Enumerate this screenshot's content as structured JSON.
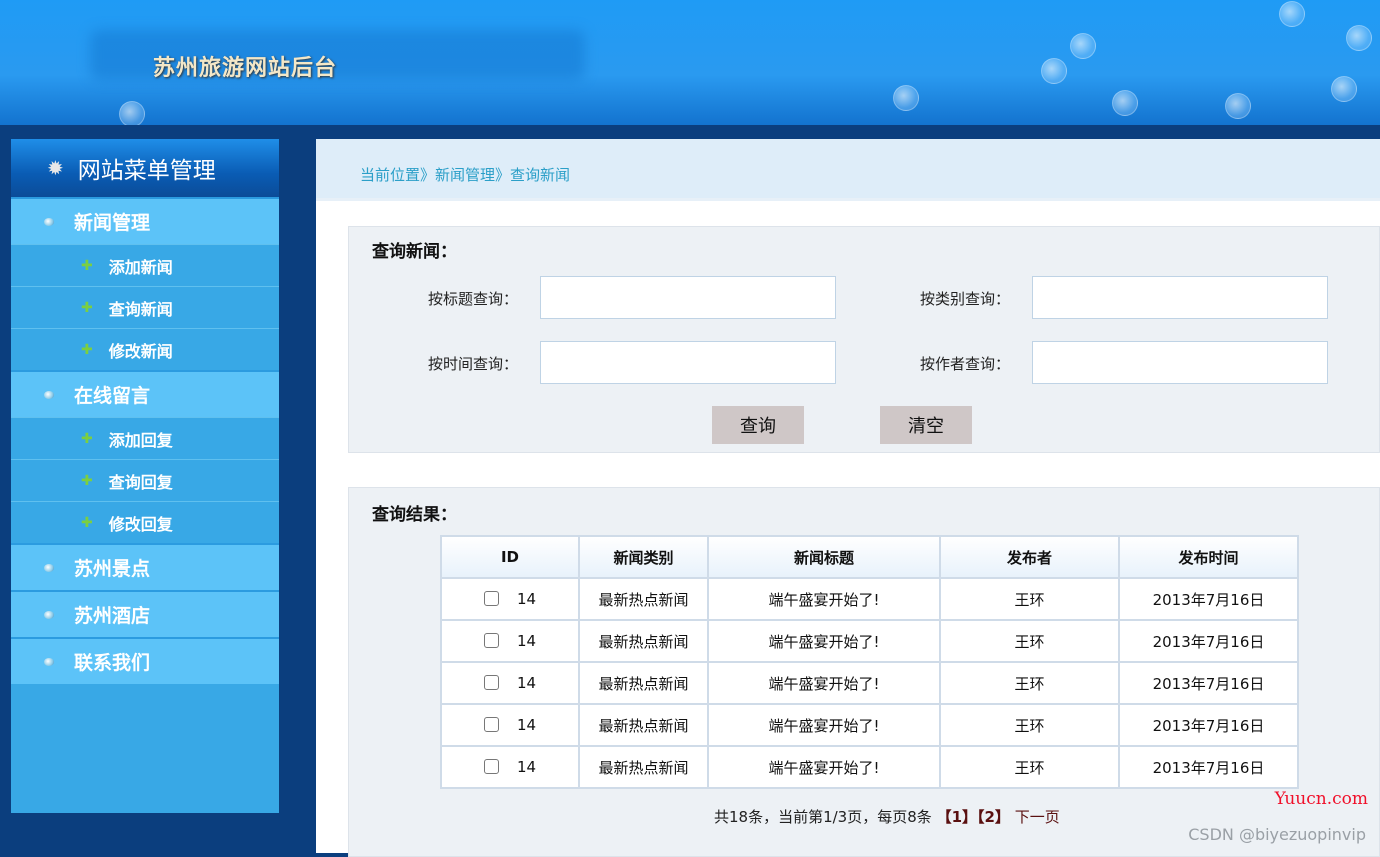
{
  "header": {
    "title": "苏州旅游网站后台"
  },
  "sidebar": {
    "title": "网站菜单管理",
    "items": [
      {
        "label": "新闻管理",
        "type": "group"
      },
      {
        "label": "添加新闻",
        "type": "sub"
      },
      {
        "label": "查询新闻",
        "type": "sub"
      },
      {
        "label": "修改新闻",
        "type": "sub"
      },
      {
        "label": "在线留言",
        "type": "group"
      },
      {
        "label": "添加回复",
        "type": "sub"
      },
      {
        "label": "查询回复",
        "type": "sub"
      },
      {
        "label": "修改回复",
        "type": "sub"
      },
      {
        "label": "苏州景点",
        "type": "group"
      },
      {
        "label": "苏州酒店",
        "type": "group"
      },
      {
        "label": "联系我们",
        "type": "group"
      }
    ]
  },
  "breadcrumb": "当前位置》新闻管理》查询新闻",
  "query": {
    "title": "查询新闻：",
    "title_label": "按标题查询：",
    "category_label": "按类别查询：",
    "time_label": "按时间查询：",
    "author_label": "按作者查询：",
    "search_button": "查询",
    "clear_button": "清空"
  },
  "results": {
    "title": "查询结果：",
    "columns": [
      "ID",
      "新闻类别",
      "新闻标题",
      "发布者",
      "发布时间"
    ],
    "rows": [
      [
        "14",
        "最新热点新闻",
        "端午盛宴开始了!",
        "王环",
        "2013年7月16日"
      ],
      [
        "14",
        "最新热点新闻",
        "端午盛宴开始了!",
        "王环",
        "2013年7月16日"
      ],
      [
        "14",
        "最新热点新闻",
        "端午盛宴开始了!",
        "王环",
        "2013年7月16日"
      ],
      [
        "14",
        "最新热点新闻",
        "端午盛宴开始了!",
        "王环",
        "2013年7月16日"
      ],
      [
        "14",
        "最新热点新闻",
        "端午盛宴开始了!",
        "王环",
        "2013年7月16日"
      ]
    ]
  },
  "pager": {
    "summary": "共18条，当前第1/3页，每页8条",
    "page1": "【1】",
    "page2": "【2】",
    "next": "下一页"
  },
  "watermarks": {
    "site": "Yuucn.com",
    "csdn": "CSDN @biyezuopinvip"
  }
}
